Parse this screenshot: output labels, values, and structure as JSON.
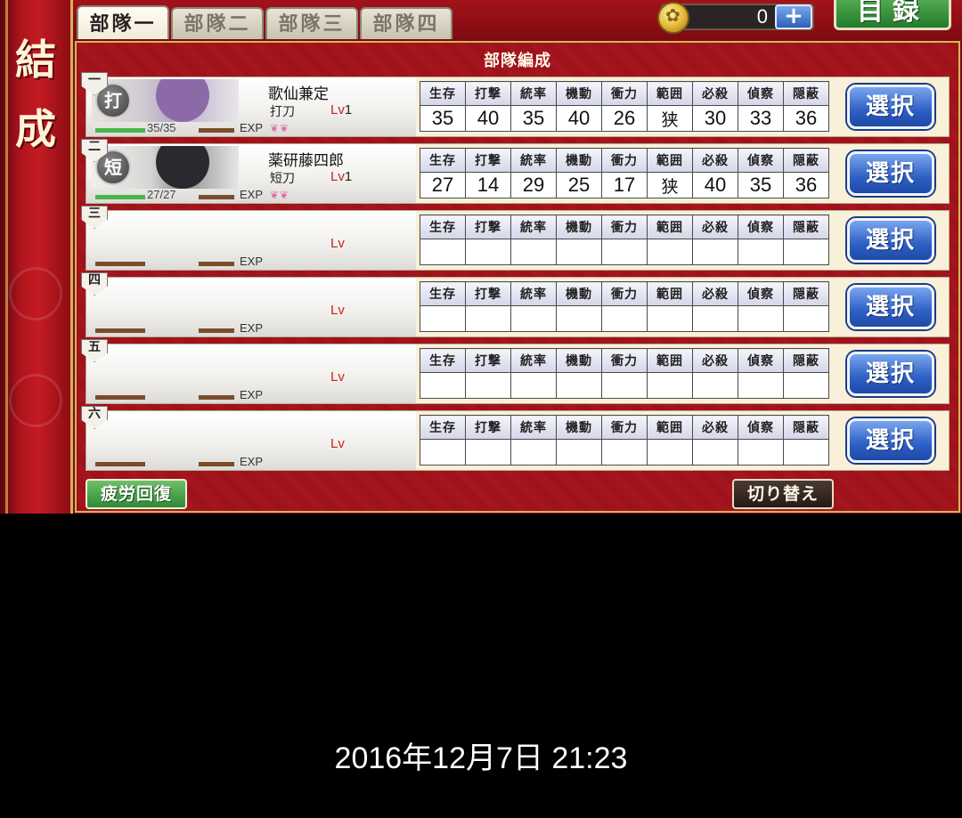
{
  "banner": {
    "title": "結成"
  },
  "tabs": [
    {
      "label": "部隊一",
      "active": true
    },
    {
      "label": "部隊二",
      "active": false
    },
    {
      "label": "部隊三",
      "active": false
    },
    {
      "label": "部隊四",
      "active": false
    }
  ],
  "currency": {
    "icon": "gold-coin-icon",
    "value": "0",
    "plus_label": "+"
  },
  "catalog_button": {
    "label": "目録"
  },
  "panel": {
    "header": "部隊編成"
  },
  "stat_headers": [
    "生存",
    "打撃",
    "統率",
    "機動",
    "衝力",
    "範囲",
    "必殺",
    "偵察",
    "隠蔽"
  ],
  "slots": [
    {
      "number": "一",
      "name": "歌仙兼定",
      "type": "打刀",
      "type_badge": "打",
      "lv_label": "Lv",
      "lv": "1",
      "hp": "35/35",
      "hp_fraction": 1.0,
      "exp_label": "EXP",
      "stats": [
        "35",
        "40",
        "35",
        "40",
        "26",
        "狭",
        "30",
        "33",
        "36"
      ],
      "select_label": "選択"
    },
    {
      "number": "二",
      "name": "薬研藤四郎",
      "type": "短刀",
      "type_badge": "短",
      "lv_label": "Lv",
      "lv": "1",
      "hp": "27/27",
      "hp_fraction": 1.0,
      "exp_label": "EXP",
      "stats": [
        "27",
        "14",
        "29",
        "25",
        "17",
        "狭",
        "40",
        "35",
        "36"
      ],
      "select_label": "選択"
    },
    {
      "number": "三",
      "lv_label": "Lv",
      "exp_label": "EXP",
      "select_label": "選択"
    },
    {
      "number": "四",
      "lv_label": "Lv",
      "exp_label": "EXP",
      "select_label": "選択"
    },
    {
      "number": "五",
      "lv_label": "Lv",
      "exp_label": "EXP",
      "select_label": "選択"
    },
    {
      "number": "六",
      "lv_label": "Lv",
      "exp_label": "EXP",
      "select_label": "選択"
    }
  ],
  "buttons": {
    "fatigue": "疲労回復",
    "switch": "切り替え"
  },
  "timestamp": "2016年12月7日 21:23",
  "colors": {
    "frame_red": "#a3121a",
    "gold": "#d6b35c",
    "select_blue": "#2d5fc5",
    "hp_green": "#4ab54a"
  }
}
